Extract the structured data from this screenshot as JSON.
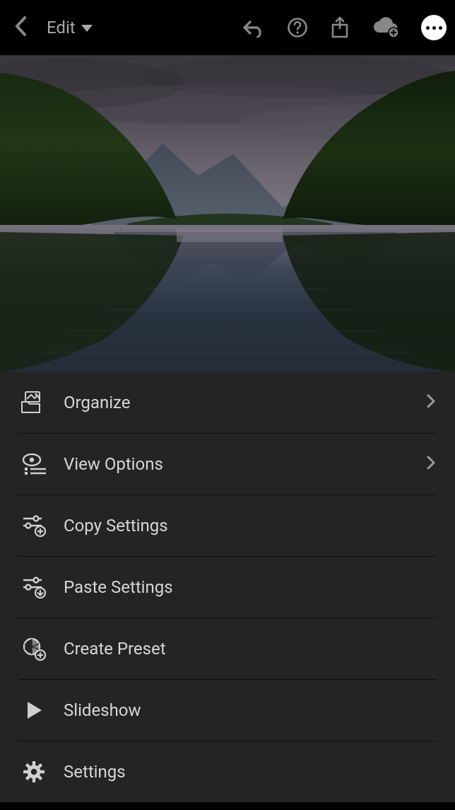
{
  "toolbar": {
    "mode_label": "Edit"
  },
  "menu": {
    "items": [
      {
        "label": "Organize",
        "icon": "organize",
        "chevron": true
      },
      {
        "label": "View Options",
        "icon": "viewoptions",
        "chevron": true
      },
      {
        "label": "Copy Settings",
        "icon": "copyset",
        "chevron": false
      },
      {
        "label": "Paste Settings",
        "icon": "pasteset",
        "chevron": false
      },
      {
        "label": "Create Preset",
        "icon": "preset",
        "chevron": false
      },
      {
        "label": "Slideshow",
        "icon": "play",
        "chevron": false
      },
      {
        "label": "Settings",
        "icon": "gear",
        "chevron": false
      }
    ]
  }
}
